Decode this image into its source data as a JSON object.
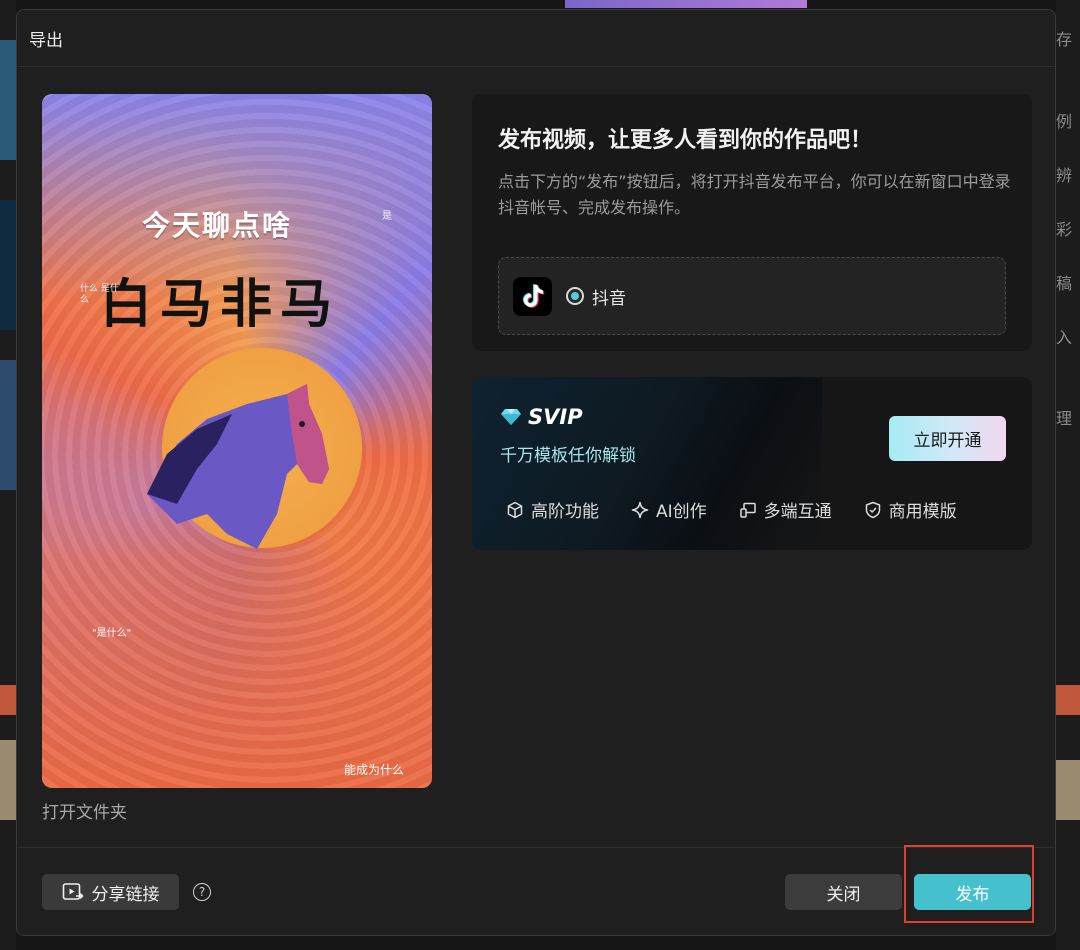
{
  "background": {
    "right_fragments": [
      "存",
      "例",
      "辨",
      "彩",
      "稿",
      "入",
      "理"
    ]
  },
  "dialog": {
    "title": "导出",
    "open_folder_label": "打开文件夹"
  },
  "preview": {
    "line1": "今天聊点啥",
    "line2": "白马非马",
    "small_top_right": "是",
    "small_left": "什么 是什么",
    "small_bottom_left": "\"是什么\"",
    "small_bottom_right": "能成为什么"
  },
  "publish": {
    "title": "发布视频，让更多人看到你的作品吧！",
    "description": "点击下方的“发布”按钮后，将打开抖音发布平台，你可以在新窗口中登录抖音帐号、完成发布操作。",
    "platform_name": "抖音",
    "platform_selected": true
  },
  "svip": {
    "label": "SVIP",
    "subtitle": "千万模板任你解锁",
    "cta": "立即开通",
    "features": [
      {
        "icon": "cube-icon",
        "label": "高阶功能"
      },
      {
        "icon": "sparkle-icon",
        "label": "AI创作"
      },
      {
        "icon": "devices-icon",
        "label": "多端互通"
      },
      {
        "icon": "shield-icon",
        "label": "商用模版"
      }
    ]
  },
  "footer": {
    "share_label": "分享链接",
    "help_symbol": "?",
    "close_label": "关闭",
    "publish_label": "发布"
  },
  "colors": {
    "accent": "#44c1cc",
    "highlight": "#e0402b",
    "svip_text": "#a9e4ec"
  }
}
